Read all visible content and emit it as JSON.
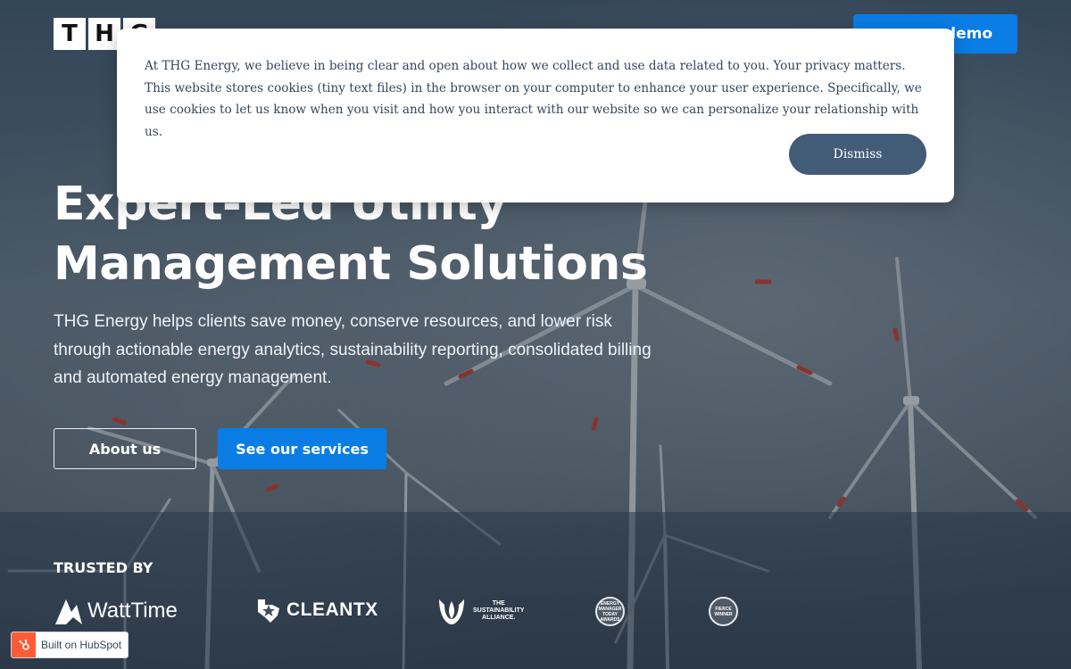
{
  "header": {
    "logo_letters": [
      "T",
      "H",
      "G"
    ],
    "demo_label": "demo"
  },
  "hero": {
    "title_line1": "Expert-Led Utility",
    "title_line2": "Management Solutions",
    "description": "THG Energy helps clients save money, conserve resources, and lower risk through actionable energy analytics, sustainability reporting, consolidated billing and automated energy management.",
    "about_label": "About us",
    "services_label": "See our services"
  },
  "trusted": {
    "label": "TRUSTED BY",
    "logos": {
      "watttime": "WattTime",
      "cleantx": "CLEANTX",
      "sustainability_line1": "THE",
      "sustainability_line2": "SUSTAINABILITY",
      "sustainability_line3": "ALLIANCE.",
      "badge1": "ENERGY MANAGER TODAY AWARDS",
      "badge2": "FIERCE WINNER"
    }
  },
  "cookie_banner": {
    "text": "At THG Energy, we believe in being clear and open about how we collect and use data related to you. Your privacy matters. This website stores cookies (tiny text files) in the browser on your computer to enhance your user experience. Specifically, we use cookies to let us know when you visit and how you interact with our website so we can personalize your relationship with us.",
    "dismiss_label": "Dismiss"
  },
  "hubspot": {
    "label": "Built on HubSpot"
  },
  "colors": {
    "primary_blue": "#0a7de5",
    "dismiss_slate": "#425b76",
    "hubspot_orange": "#ff5c35"
  }
}
